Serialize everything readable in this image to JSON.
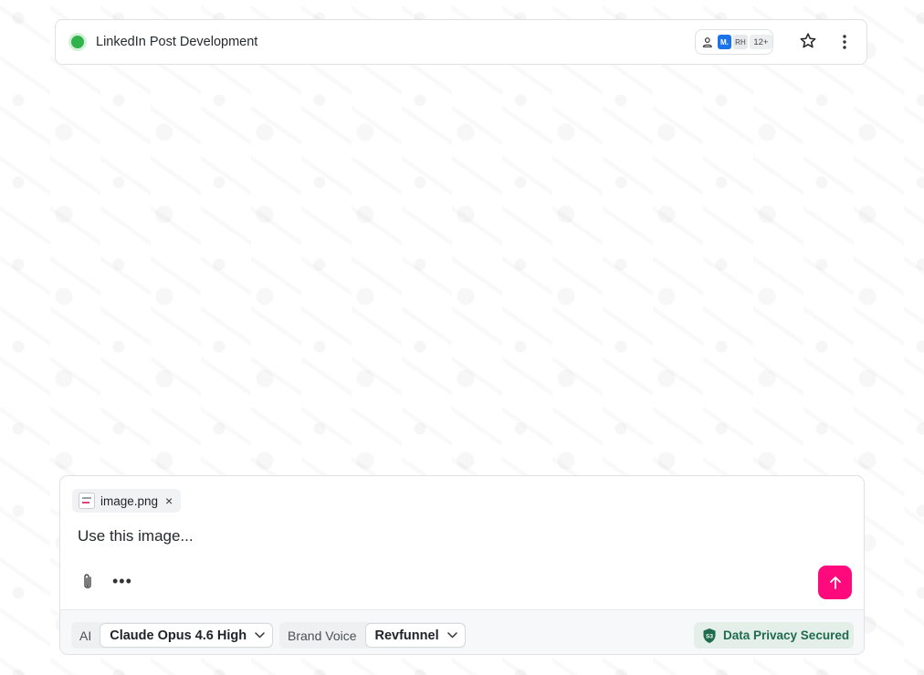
{
  "header": {
    "title": "LinkedIn Post Development",
    "status_color": "#2fb34a",
    "avatars": [
      {
        "initials": "M.",
        "color": "#1a73e8"
      },
      {
        "initials": "RH",
        "color": "#e6e8eb"
      }
    ],
    "more_count": "12+",
    "icons": [
      "person-icon",
      "star-icon",
      "more-vertical-icon"
    ]
  },
  "composer": {
    "attachment": {
      "name": "image.png"
    },
    "message": "Use this image...",
    "icons": [
      "paperclip-icon",
      "more-horizontal-icon",
      "arrow-up-icon"
    ],
    "send_color": "#ff0a7c",
    "footer": {
      "ai_label": "AI",
      "ai_model": "Claude Opus 4.6 High",
      "brand_voice_label": "Brand Voice",
      "brand_voice_value": "Revfunnel",
      "privacy_badge": "S3",
      "privacy_text": "Data Privacy Secured"
    }
  }
}
